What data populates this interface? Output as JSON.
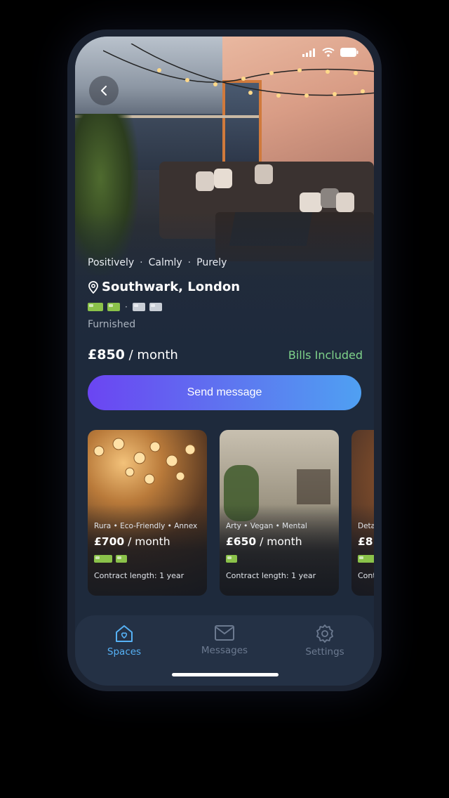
{
  "listing": {
    "tags": [
      "Positively",
      "Calmly",
      "Purely"
    ],
    "location": "Southwark, London",
    "beds_available": 2,
    "beds_taken": 2,
    "furnishing": "Furnished",
    "price": "£850",
    "price_unit": "/ month",
    "bills": "Bills Included",
    "send_button": "Send message"
  },
  "cards": [
    {
      "tags": "Rura • Eco-Friendly • Annex",
      "price": "£700",
      "unit": "/ month",
      "beds": 2,
      "contract": "Contract length: 1 year"
    },
    {
      "tags": "Arty • Vegan • Mental",
      "price": "£650",
      "unit": "/ month",
      "beds": 1,
      "contract": "Contract length: 1 year"
    },
    {
      "tags": "Deta",
      "price": "£8",
      "unit": "",
      "beds": 1,
      "contract": "Cont"
    }
  ],
  "tabbar": {
    "spaces": "Spaces",
    "messages": "Messages",
    "settings": "Settings"
  },
  "colors": {
    "accent": "#56b1f5",
    "bills": "#7fd38a",
    "button_start": "#6b45f2",
    "button_end": "#4fa0f2",
    "bed_available": "#8bc24a",
    "bed_taken": "#c9ced6"
  },
  "icons": {
    "back": "chevron-left-icon",
    "location": "map-pin-icon",
    "spaces": "house-heart-icon",
    "messages": "envelope-icon",
    "settings": "gear-icon"
  }
}
